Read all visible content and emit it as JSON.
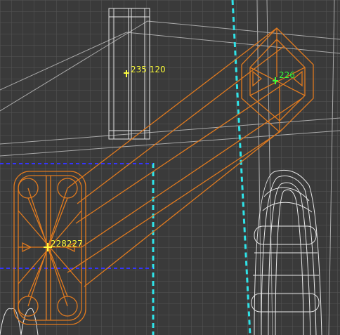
{
  "viewport": {
    "background": "#3a3a3a",
    "grid_color": "#5b5b5b",
    "wire_color": "#d8d8d8",
    "selection_color": "#e07a1f",
    "guide_cyan": "#2fe3e8",
    "guide_blue": "#2a2aff"
  },
  "annotations": [
    {
      "id": "yellow_top",
      "text": "235 120",
      "color": "#ffff40"
    },
    {
      "id": "green_right",
      "text": "226",
      "color": "#3bff3b"
    },
    {
      "id": "yellow_left",
      "text": "228227",
      "color": "#ffff40"
    }
  ]
}
